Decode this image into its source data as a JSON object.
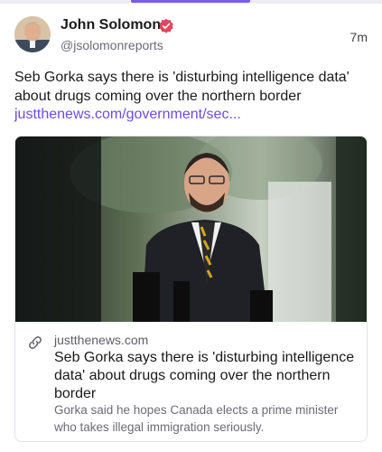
{
  "post": {
    "author_name": "John Solomon",
    "author_handle": "@jsolomonreports",
    "timestamp": "7m",
    "text": "Seb Gorka says there is 'disturbing intelligence data' about drugs coming over the northern border",
    "link_text": "justthenews.com/government/sec..."
  },
  "link_card": {
    "domain": "justthenews.com",
    "title": "Seb Gorka says there is 'disturbing intelligence data' about drugs coming over the northern border",
    "description": "Gorka said he hopes Canada elects a prime minister who takes illegal immigration seriously."
  },
  "icons": {
    "verified": "verified-badge-icon",
    "link": "link-icon"
  },
  "colors": {
    "accent": "#7b5cf0",
    "link": "#6c4bea",
    "verified": "#e3445e"
  }
}
